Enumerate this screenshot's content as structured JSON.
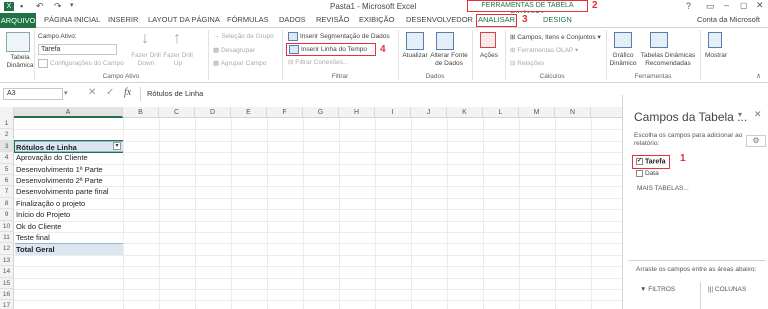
{
  "window": {
    "title": "Pasta1 - Microsoft Excel",
    "context_tab_group": "FERRAMENTAS DE TABELA DINÂMICA",
    "window_controls": "? ▢ – ▢ ✕",
    "account": "Conta da Microsoft"
  },
  "annotations": {
    "a1": "1",
    "a2": "2",
    "a3": "3",
    "a4": "4"
  },
  "tabs": {
    "arquivo": "ARQUIVO",
    "items": [
      "PÁGINA INICIAL",
      "INSERIR",
      "LAYOUT DA PÁGINA",
      "FÓRMULAS",
      "DADOS",
      "REVISÃO",
      "EXIBIÇÃO",
      "DESENVOLVEDOR"
    ],
    "analisar": "ANALISAR",
    "design": "DESIGN"
  },
  "ribbon": {
    "tabela_dinamica": "Tabela Dinâmica",
    "campo_ativo_label": "Campo Ativo:",
    "campo_ativo_value": "Tarefa",
    "config_campo": "Configurações do Campo",
    "fazer_drill_down": "Fazer Drill Down",
    "fazer_drill_up": "Fazer Drill Up",
    "grupo_campo_ativo": "Campo Ativo",
    "selecao_grupo": "Seleção de Grupo",
    "desagrupar": "Desagrupar",
    "agrupar_campo": "Agrupar Campo",
    "inserir_segmentacao": "Inserir Segmentação de Dados",
    "inserir_linha_tempo": "Inserir Linha do Tempo",
    "filtrar_conexoes": "Filtrar Conexões...",
    "grupo_filtrar": "Filtrar",
    "atualizar": "Atualizar",
    "alterar_fonte": "Alterar Fonte de Dados",
    "grupo_dados": "Dados",
    "acoes": "Ações",
    "campos_itens": "Campos, Itens e Conjuntos",
    "ferramentas_olap": "Ferramentas OLAP",
    "relacoes": "Relações",
    "grupo_calculos": "Cálculos",
    "grafico_dinamico": "Gráfico Dinâmico",
    "tabelas_recomendadas": "Tabelas Dinâmicas Recomendadas",
    "grupo_ferramentas": "Ferramentas",
    "mostrar": "Mostrar"
  },
  "formula_bar": {
    "name_box": "A3",
    "fx": "fx",
    "content": "Rótulos de Linha"
  },
  "grid": {
    "columns": [
      "A",
      "B",
      "C",
      "D",
      "E",
      "F",
      "G",
      "H",
      "I",
      "J",
      "K",
      "L",
      "M",
      "N"
    ],
    "rows": [
      "1",
      "2",
      "3",
      "4",
      "5",
      "6",
      "7",
      "8",
      "9",
      "10",
      "11",
      "12",
      "13",
      "14",
      "15",
      "16",
      "17"
    ],
    "cells": [
      "",
      "",
      "Rótulos de Linha",
      "Aprovação do Cliente",
      "Desenvolvimento 1ª Parte",
      "Desenvolvimento 2ª Parte",
      "Desenvolvimento parte final",
      "Finalização o projeto",
      "Início do Projeto",
      "Ok do Cliente",
      "Teste final",
      "Total Geral"
    ]
  },
  "pane": {
    "title": "Campos da Tabela ...",
    "description": "Escolha os campos para adicionar ao relatório:",
    "fields": [
      "Tarefa",
      "Data"
    ],
    "more_tables": "MAIS TABELAS...",
    "drag_text": "Arraste os campos entre as áreas abaixo:",
    "filtros": "FILTROS",
    "colunas": "COLUNAS"
  }
}
